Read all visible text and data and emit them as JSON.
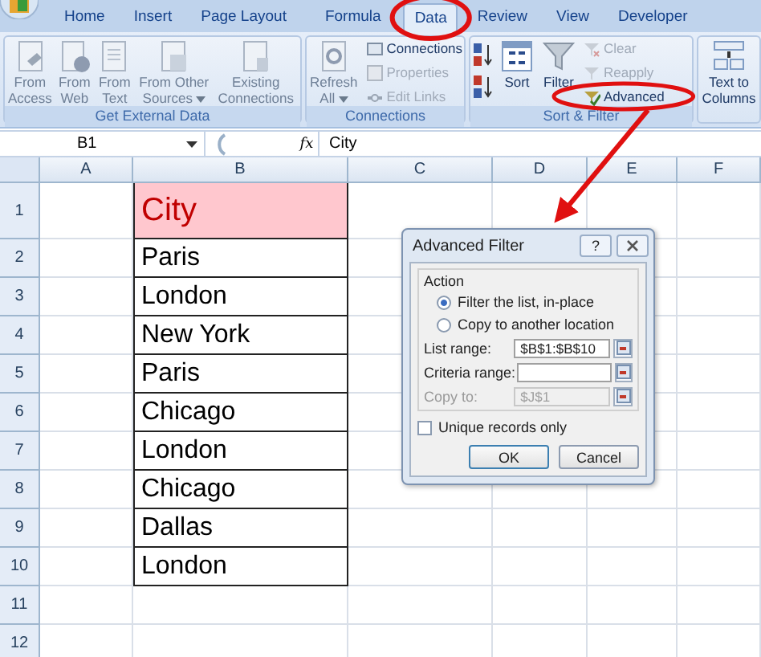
{
  "ribbon": {
    "tabs": [
      {
        "label": "Home",
        "selected": false
      },
      {
        "label": "Insert",
        "selected": false
      },
      {
        "label": "Page Layout",
        "selected": false
      },
      {
        "label": "Formula",
        "selected": false
      },
      {
        "label": "Data",
        "selected": true
      },
      {
        "label": "Review",
        "selected": false
      },
      {
        "label": "View",
        "selected": false
      },
      {
        "label": "Developer",
        "selected": false
      }
    ],
    "groups": [
      {
        "title": "Get External Data",
        "commands": [
          {
            "kind": "large",
            "label": "From Access",
            "dropdown": false
          },
          {
            "kind": "large",
            "label": "From Web",
            "dropdown": false
          },
          {
            "kind": "large",
            "label": "From Text",
            "dropdown": false
          },
          {
            "kind": "large",
            "label": "From Other Sources",
            "dropdown": true
          },
          {
            "kind": "large",
            "label": "Existing Connections",
            "dropdown": false
          }
        ]
      },
      {
        "title": "Connections",
        "commands": [
          {
            "kind": "large",
            "label": "Refresh All",
            "dropdown": true
          },
          {
            "kind": "small",
            "label": "Connections",
            "disabled": false
          },
          {
            "kind": "small",
            "label": "Properties",
            "disabled": true
          },
          {
            "kind": "small",
            "label": "Edit Links",
            "disabled": true
          }
        ]
      },
      {
        "title": "Sort & Filter",
        "commands": [
          {
            "kind": "sort-pair"
          },
          {
            "kind": "large",
            "label": "Sort",
            "dropdown": false
          },
          {
            "kind": "large",
            "label": "Filter",
            "dropdown": false
          },
          {
            "kind": "small",
            "label": "Clear",
            "disabled": true
          },
          {
            "kind": "small",
            "label": "Reapply",
            "disabled": true
          },
          {
            "kind": "small",
            "label": "Advanced",
            "disabled": false
          }
        ]
      },
      {
        "commands": [
          {
            "kind": "large",
            "label": "Text to Columns",
            "dropdown": false
          }
        ]
      }
    ]
  },
  "formula_bar": {
    "name_box": "B1",
    "function_label": "fx",
    "value": "City"
  },
  "sheet": {
    "columns": [
      "A",
      "B",
      "C",
      "D",
      "E",
      "F"
    ],
    "rows": [
      {
        "number": "1",
        "value": "City",
        "highlighted": true
      },
      {
        "number": "2",
        "value": "Paris",
        "highlighted": false
      },
      {
        "number": "3",
        "value": "London",
        "highlighted": false
      },
      {
        "number": "4",
        "value": "New York",
        "highlighted": false
      },
      {
        "number": "5",
        "value": "Paris",
        "highlighted": false
      },
      {
        "number": "6",
        "value": "Chicago",
        "highlighted": false
      },
      {
        "number": "7",
        "value": "London",
        "highlighted": false
      },
      {
        "number": "8",
        "value": "Chicago",
        "highlighted": false
      },
      {
        "number": "9",
        "value": "Dallas",
        "highlighted": false
      },
      {
        "number": "10",
        "value": "London",
        "highlighted": false
      },
      {
        "number": "11"
      },
      {
        "number": "12"
      }
    ]
  },
  "dialog": {
    "title": "Advanced Filter",
    "help": "?",
    "section": "Action",
    "options": [
      {
        "label": "Filter the list, in-place",
        "selected": true
      },
      {
        "label": "Copy to another location",
        "selected": false
      }
    ],
    "fields": [
      {
        "label": "List range:",
        "value": "$B$1:$B$10",
        "disabled": false
      },
      {
        "label": "Criteria range:",
        "disabled": false
      },
      {
        "label": "Copy to:",
        "value": "$J$1",
        "disabled": true
      }
    ],
    "checkbox": {
      "label": "Unique records only",
      "checked": false
    },
    "buttons": [
      "OK",
      "Cancel"
    ]
  }
}
